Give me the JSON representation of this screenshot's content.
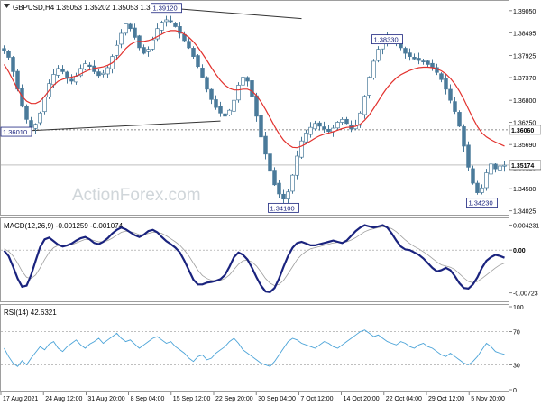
{
  "header": {
    "symbol": "GBPUSD,H4",
    "ohlc": "1.35053 1.35202 1.35053 1.35174"
  },
  "watermark": "ActionForex.com",
  "colors": {
    "candle": "#4a7a9a",
    "ma": "#e2312d",
    "macd_main": "#1a237e",
    "macd_signal": "#9e9e9e",
    "rsi": "#4aa3d8",
    "trendline": "#333333",
    "hline": "#666666",
    "label_border": "#1a237e",
    "label_text": "#1a237e",
    "grid": "#cccccc"
  },
  "chart_data": [
    {
      "type": "candlestick",
      "panel": "price",
      "y_ticks": [
        "1.39050",
        "1.38495",
        "1.37925",
        "1.37370",
        "1.36800",
        "1.36250",
        "1.35690",
        "1.35120",
        "1.34580",
        "1.34025"
      ],
      "ylim": [
        1.3395,
        1.3925
      ],
      "x_ticks": [
        "17 Aug 2021",
        "24 Aug 12:00",
        "31 Aug 20:00",
        "8 Sep 04:00",
        "15 Sep 12:00",
        "22 Sep 20:00",
        "30 Sep 04:00",
        "7 Oct 12:00",
        "14 Oct 20:00",
        "22 Oct 04:00",
        "29 Oct 12:00",
        "5 Nov 20:00"
      ],
      "close_path": [
        1.3805,
        1.3788,
        1.3752,
        1.3708,
        1.3665,
        1.3632,
        1.3612,
        1.362,
        1.3648,
        1.3688,
        1.3722,
        1.3745,
        1.376,
        1.3752,
        1.3735,
        1.3728,
        1.374,
        1.376,
        1.3772,
        1.3765,
        1.3752,
        1.3742,
        1.3748,
        1.3762,
        1.379,
        1.3818,
        1.3848,
        1.3872,
        1.386,
        1.3838,
        1.3812,
        1.3798,
        1.3808,
        1.3832,
        1.386,
        1.3876,
        1.3882,
        1.3878,
        1.3865,
        1.3848,
        1.383,
        1.3812,
        1.379,
        1.3765,
        1.3738,
        1.3708,
        1.3682,
        1.3662,
        1.3648,
        1.364,
        1.3655,
        1.368,
        1.3718,
        1.3738,
        1.3728,
        1.369,
        1.364,
        1.3588,
        1.3545,
        1.3502,
        1.3468,
        1.3445,
        1.3432,
        1.345,
        1.3492,
        1.354,
        1.3578,
        1.3598,
        1.3612,
        1.3622,
        1.3615,
        1.3608,
        1.3602,
        1.361,
        1.3625,
        1.3632,
        1.3622,
        1.3608,
        1.3618,
        1.3648,
        1.369,
        1.3738,
        1.3778,
        1.3808,
        1.3828,
        1.3838,
        1.3835,
        1.3825,
        1.3812,
        1.3798,
        1.379,
        1.3784,
        1.378,
        1.3778,
        1.377,
        1.3762,
        1.375,
        1.3732,
        1.3708,
        1.368,
        1.3652,
        1.3615,
        1.3565,
        1.3512,
        1.3472,
        1.3448,
        1.346,
        1.3498,
        1.352,
        1.3508,
        1.3515,
        1.3517
      ],
      "ma_path": [
        1.377,
        1.3752,
        1.373,
        1.3708,
        1.369,
        1.3678,
        1.3672,
        1.3672,
        1.3678,
        1.369,
        1.3705,
        1.3718,
        1.3728,
        1.3733,
        1.3736,
        1.3738,
        1.3741,
        1.3746,
        1.3752,
        1.3757,
        1.376,
        1.3762,
        1.3764,
        1.3768,
        1.3774,
        1.3784,
        1.3796,
        1.381,
        1.382,
        1.3826,
        1.3828,
        1.3828,
        1.383,
        1.3834,
        1.384,
        1.3846,
        1.3852,
        1.3855,
        1.3855,
        1.3852,
        1.3846,
        1.3838,
        1.3827,
        1.3813,
        1.3797,
        1.378,
        1.3762,
        1.3745,
        1.373,
        1.3718,
        1.371,
        1.3706,
        1.3706,
        1.3708,
        1.3708,
        1.3703,
        1.3692,
        1.3676,
        1.3657,
        1.3636,
        1.3615,
        1.3596,
        1.358,
        1.3569,
        1.3562,
        1.3561,
        1.3565,
        1.3571,
        1.3578,
        1.3585,
        1.3591,
        1.3595,
        1.3598,
        1.3601,
        1.3605,
        1.3609,
        1.3612,
        1.3613,
        1.3615,
        1.362,
        1.363,
        1.3643,
        1.366,
        1.3678,
        1.3696,
        1.3712,
        1.3725,
        1.3736,
        1.3744,
        1.375,
        1.3755,
        1.3759,
        1.3762,
        1.3763,
        1.3763,
        1.3762,
        1.3759,
        1.3754,
        1.3746,
        1.3735,
        1.3721,
        1.3703,
        1.3682,
        1.3658,
        1.3635,
        1.3614,
        1.3598,
        1.3588,
        1.3581,
        1.3575,
        1.357,
        1.3565
      ],
      "hline_level": 1.3606,
      "current_price": 1.35174,
      "labels": [
        {
          "text": "1.39120",
          "bar": 36,
          "value": 1.3912
        },
        {
          "text": "1.38330",
          "bar": 85,
          "value": 1.3833
        },
        {
          "text": "1.36010",
          "bar": 1,
          "value": 1.3601
        },
        {
          "text": "1.34100",
          "bar": 62,
          "value": 1.341
        },
        {
          "text": "1.34230",
          "bar": 106,
          "value": 1.3423
        }
      ],
      "trendlines": [
        {
          "from_bar": 36,
          "from_value": 1.3912,
          "to_bar": 66,
          "to_value": 1.3885
        },
        {
          "from_bar": 1,
          "from_value": 1.3601,
          "to_bar": 48,
          "to_value": 1.3628
        }
      ]
    },
    {
      "type": "line",
      "panel": "macd",
      "title": "MACD(12,26,9) -0.001259 -0.001074",
      "y_ticks": [
        "0.004231",
        "0.00",
        "-0.00723"
      ],
      "ylim": [
        -0.0085,
        0.0052
      ],
      "main_path": [
        -0.0001,
        -0.001,
        -0.0028,
        -0.0048,
        -0.0062,
        -0.006,
        -0.0042,
        -0.0018,
        0.0005,
        0.0018,
        0.0021,
        0.0015,
        0.0009,
        0.0006,
        0.0008,
        0.0011,
        0.0016,
        0.002,
        0.0022,
        0.0018,
        0.0012,
        0.001,
        0.0014,
        0.002,
        0.0028,
        0.0034,
        0.0038,
        0.0035,
        0.003,
        0.0025,
        0.0022,
        0.0026,
        0.0032,
        0.0034,
        0.003,
        0.0022,
        0.0015,
        0.001,
        0.0004,
        -0.0004,
        -0.0018,
        -0.0034,
        -0.005,
        -0.0058,
        -0.0058,
        -0.0055,
        -0.0054,
        -0.0052,
        -0.0049,
        -0.0042,
        -0.0028,
        -0.0012,
        -0.0004,
        -0.0008,
        -0.0016,
        -0.003,
        -0.0046,
        -0.006,
        -0.007,
        -0.0071,
        -0.0064,
        -0.0048,
        -0.0028,
        -0.001,
        0.0004,
        0.0012,
        0.0014,
        0.0011,
        0.0008,
        0.0008,
        0.001,
        0.0012,
        0.0014,
        0.0016,
        0.0014,
        0.0012,
        0.0016,
        0.0024,
        0.0032,
        0.0038,
        0.0042,
        0.004,
        0.0038,
        0.004,
        0.0042,
        0.0038,
        0.0028,
        0.0016,
        0.0006,
        0.0001,
        0.0,
        -0.0004,
        -0.0008,
        -0.0014,
        -0.0022,
        -0.003,
        -0.0036,
        -0.0034,
        -0.003,
        -0.0034,
        -0.0044,
        -0.0056,
        -0.0064,
        -0.0065,
        -0.0058,
        -0.0046,
        -0.003,
        -0.0018,
        -0.0012,
        -0.0008,
        -0.001,
        -0.0013
      ],
      "signal_path": [
        0.0002,
        -0.0002,
        -0.001,
        -0.0022,
        -0.0036,
        -0.0046,
        -0.0048,
        -0.0042,
        -0.003,
        -0.0016,
        -0.0004,
        0.0004,
        0.0008,
        0.0008,
        0.0008,
        0.0009,
        0.0012,
        0.0015,
        0.0018,
        0.0018,
        0.0016,
        0.0014,
        0.0014,
        0.0016,
        0.002,
        0.0025,
        0.003,
        0.0032,
        0.0031,
        0.0029,
        0.0026,
        0.0026,
        0.0028,
        0.003,
        0.003,
        0.0028,
        0.0024,
        0.0019,
        0.0014,
        0.0008,
        0.0,
        -0.001,
        -0.0022,
        -0.0034,
        -0.0043,
        -0.0048,
        -0.0051,
        -0.0052,
        -0.0051,
        -0.0048,
        -0.0042,
        -0.0033,
        -0.0024,
        -0.0018,
        -0.0017,
        -0.002,
        -0.0027,
        -0.0037,
        -0.0048,
        -0.0056,
        -0.006,
        -0.0058,
        -0.0051,
        -0.004,
        -0.0028,
        -0.0016,
        -0.0008,
        -0.0002,
        0.0002,
        0.0004,
        0.0006,
        0.0008,
        0.001,
        0.0012,
        0.0013,
        0.0013,
        0.0014,
        0.0017,
        0.0021,
        0.0026,
        0.0031,
        0.0034,
        0.0036,
        0.0038,
        0.0039,
        0.0039,
        0.0036,
        0.0031,
        0.0024,
        0.0017,
        0.0011,
        0.0006,
        0.0002,
        -0.0003,
        -0.0008,
        -0.0014,
        -0.002,
        -0.0025,
        -0.0027,
        -0.0029,
        -0.0033,
        -0.004,
        -0.0047,
        -0.0053,
        -0.0055,
        -0.0053,
        -0.0048,
        -0.0042,
        -0.0036,
        -0.003,
        -0.0025,
        -0.0022
      ]
    },
    {
      "type": "line",
      "panel": "rsi",
      "title": "RSI(14) 42.6321",
      "y_ticks": [
        "100",
        "70",
        "30",
        "0"
      ],
      "ylim": [
        0,
        100
      ],
      "levels": [
        70,
        30
      ],
      "rsi_path": [
        50,
        40,
        32,
        28,
        35,
        30,
        38,
        45,
        52,
        48,
        55,
        58,
        50,
        46,
        52,
        56,
        60,
        54,
        50,
        55,
        58,
        62,
        56,
        60,
        64,
        68,
        62,
        58,
        60,
        55,
        50,
        54,
        58,
        62,
        64,
        60,
        56,
        58,
        52,
        48,
        44,
        38,
        34,
        40,
        42,
        36,
        38,
        44,
        48,
        52,
        58,
        62,
        56,
        48,
        44,
        40,
        36,
        32,
        30,
        28,
        34,
        42,
        50,
        58,
        62,
        60,
        56,
        54,
        52,
        50,
        54,
        58,
        56,
        52,
        50,
        54,
        58,
        62,
        66,
        70,
        72,
        68,
        64,
        66,
        62,
        58,
        56,
        54,
        58,
        56,
        52,
        50,
        54,
        56,
        52,
        50,
        46,
        42,
        40,
        44,
        40,
        36,
        32,
        30,
        34,
        40,
        48,
        56,
        52,
        46,
        44,
        42.6
      ]
    }
  ]
}
